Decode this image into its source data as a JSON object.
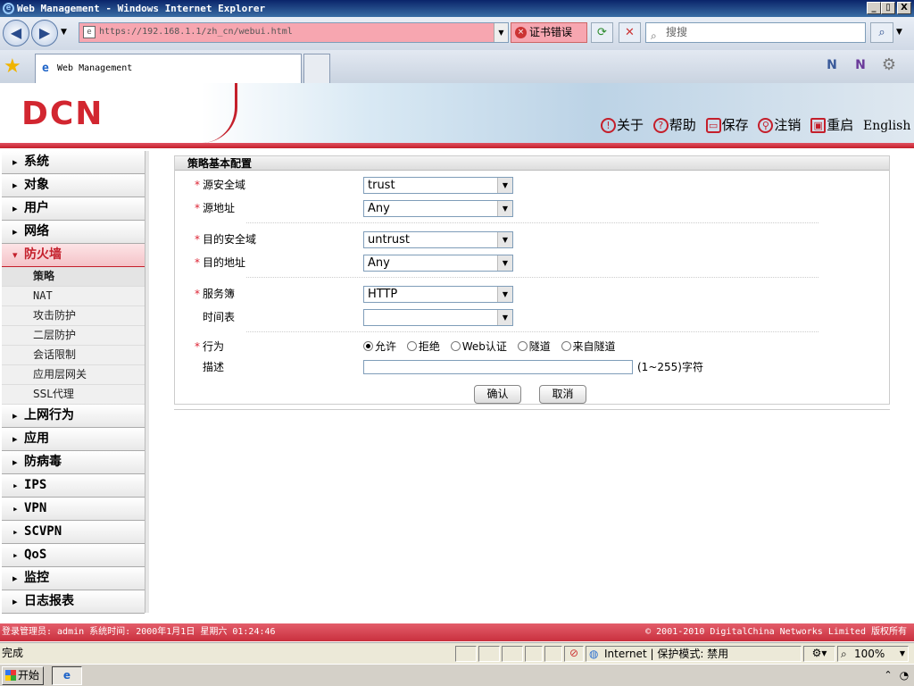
{
  "window": {
    "title": "Web Management - Windows Internet Explorer",
    "min": "_",
    "max": "▯",
    "close": "X"
  },
  "browser": {
    "url": "https://192.168.1.1/zh_cn/webui.html",
    "cert_error": "证书错误",
    "search_placeholder": "搜搜",
    "tab_title": "Web Management"
  },
  "header": {
    "logo": "DCN",
    "links": {
      "about": "关于",
      "help": "帮助",
      "save": "保存",
      "logout": "注销",
      "reboot": "重启",
      "english": "English"
    }
  },
  "sidebar": {
    "top": [
      "系统",
      "对象",
      "用户",
      "网络"
    ],
    "open": "防火墙",
    "sub": [
      "策略",
      "NAT",
      "攻击防护",
      "二层防护",
      "会话限制",
      "应用层网关",
      "SSL代理"
    ],
    "bottom": [
      "上网行为",
      "应用",
      "防病毒",
      "IPS",
      "VPN",
      "SCVPN",
      "QoS",
      "监控",
      "日志报表"
    ]
  },
  "form": {
    "title": "策略基本配置",
    "src_zone_label": "源安全域",
    "src_zone": "trust",
    "src_addr_label": "源地址",
    "src_addr": "Any",
    "dst_zone_label": "目的安全域",
    "dst_zone": "untrust",
    "dst_addr_label": "目的地址",
    "dst_addr": "Any",
    "service_label": "服务簿",
    "service": "HTTP",
    "schedule_label": "时间表",
    "schedule": "",
    "action_label": "行为",
    "actions": [
      "允许",
      "拒绝",
      "Web认证",
      "隧道",
      "来自隧道"
    ],
    "action_selected": "允许",
    "desc_label": "描述",
    "desc": "",
    "desc_hint": "(1~255)字符",
    "ok": "确认",
    "cancel": "取消"
  },
  "footer": {
    "left": "登录管理员: admin 系统时间: 2000年1月1日 星期六 01:24:46",
    "right": "© 2001-2010 DigitalChina Networks Limited 版权所有"
  },
  "status": {
    "text": "完成",
    "zone": "Internet | 保护模式: 禁用",
    "zoom": "100%"
  },
  "taskbar": {
    "start": "开始"
  }
}
